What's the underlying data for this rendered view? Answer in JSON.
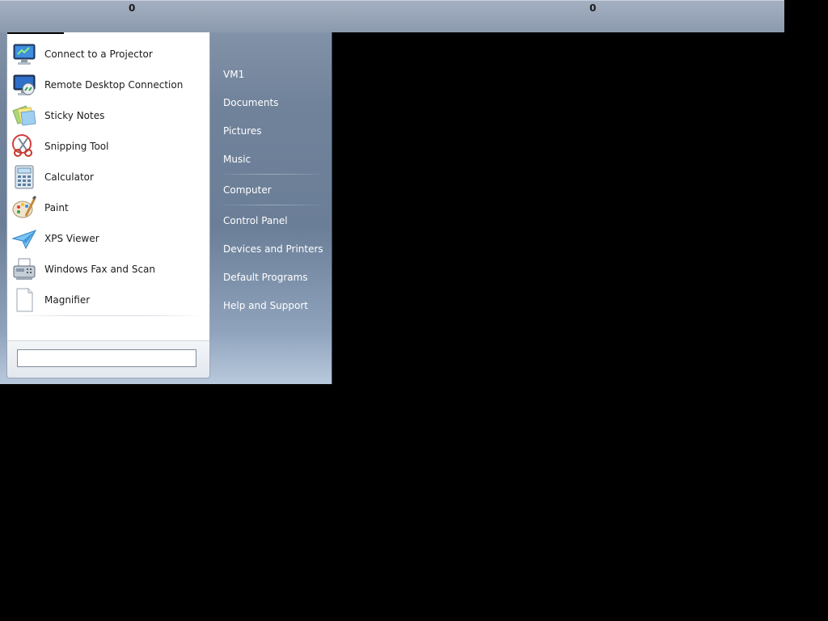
{
  "topbar": {
    "counter_left": "0",
    "counter_right": "0"
  },
  "start_menu": {
    "programs": [
      {
        "label": "Connect to a Projector",
        "icon": "projector-icon"
      },
      {
        "label": "Remote Desktop Connection",
        "icon": "remote-desktop-icon"
      },
      {
        "label": "Sticky Notes",
        "icon": "sticky-notes-icon"
      },
      {
        "label": "Snipping Tool",
        "icon": "scissors-icon"
      },
      {
        "label": "Calculator",
        "icon": "calculator-icon"
      },
      {
        "label": "Paint",
        "icon": "paint-palette-icon"
      },
      {
        "label": "XPS Viewer",
        "icon": "paper-plane-icon"
      },
      {
        "label": "Windows Fax and Scan",
        "icon": "fax-icon"
      },
      {
        "label": "Magnifier",
        "icon": "blank-document-icon"
      }
    ],
    "search": {
      "value": "",
      "placeholder": ""
    },
    "right_items": {
      "user": "VM1",
      "documents": "Documents",
      "pictures": "Pictures",
      "music": "Music",
      "computer": "Computer",
      "control_panel": "Control Panel",
      "devices_printers": "Devices and Printers",
      "default_programs": "Default Programs",
      "help_support": "Help and Support"
    }
  }
}
